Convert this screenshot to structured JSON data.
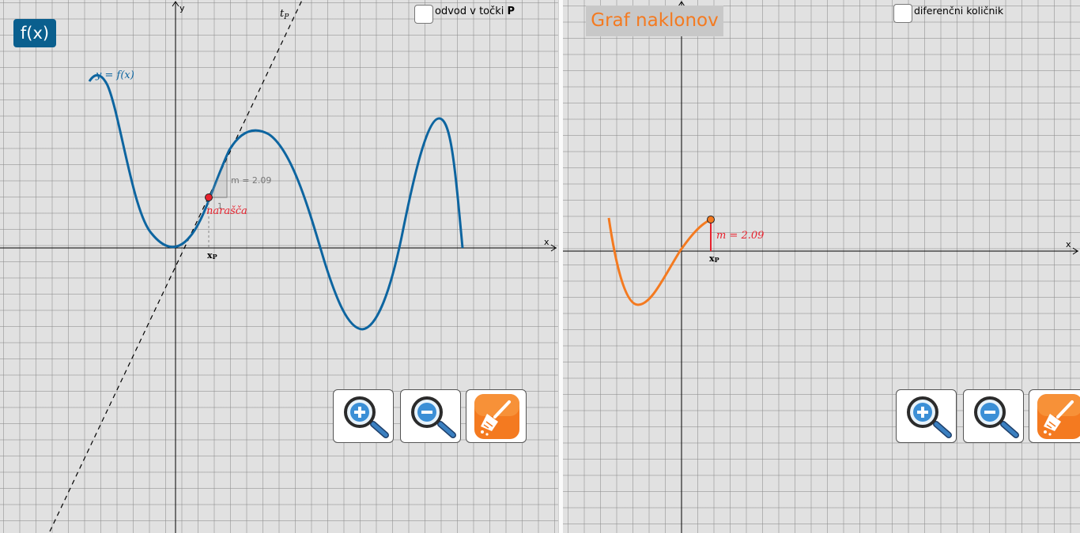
{
  "left_panel": {
    "badge_label": "f(x)",
    "checkbox": {
      "label": "odvod v točki ",
      "label_bold": "P",
      "checked": false
    },
    "axis_x_label": "x",
    "axis_y_label": "y",
    "curve_label": "y = f(x)",
    "tangent_label": "t",
    "tangent_sub": "P",
    "slope_text": "m = 2.09",
    "slope_run_text": "1",
    "status_text": "narašča",
    "point_x_label": "x",
    "point_x_sub": "P",
    "buttons": [
      {
        "name": "zoom-in",
        "icon": "zoom-in-icon"
      },
      {
        "name": "zoom-out",
        "icon": "zoom-out-icon"
      },
      {
        "name": "clear",
        "icon": "broom-icon"
      }
    ],
    "colors": {
      "curve": "#0d65a0",
      "point": "#e8212d",
      "label": "#e8212d",
      "badge": "#0a5f8e"
    }
  },
  "right_panel": {
    "title": "Graf naklonov",
    "checkbox": {
      "label": "diferenčni količnik",
      "checked": false
    },
    "axis_x_label": "x",
    "slope_text": "m = 2.09",
    "point_x_label": "x",
    "point_x_sub": "P",
    "buttons": [
      {
        "name": "zoom-in",
        "icon": "zoom-in-icon"
      },
      {
        "name": "zoom-out",
        "icon": "zoom-out-icon"
      },
      {
        "name": "clear",
        "icon": "broom-icon"
      }
    ],
    "colors": {
      "curve": "#f47a20",
      "point": "#f47a20",
      "label": "#e8212d",
      "title": "#f47a20"
    }
  }
}
